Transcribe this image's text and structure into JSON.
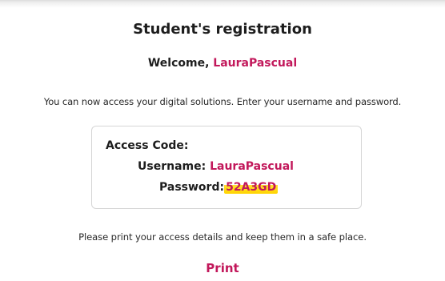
{
  "page": {
    "title": "Student's registration",
    "welcome_prefix": "Welcome, ",
    "welcome_name": "LauraPascual",
    "intro": "You can now access your digital solutions. Enter your username and password."
  },
  "credentials": {
    "access_code_label": "Access Code:",
    "username_label": "Username: ",
    "username_value": "LauraPascual",
    "password_label": "Password:",
    "password_value": "52A3GD"
  },
  "footer": {
    "note": "Please print your access details and keep them in a safe place.",
    "print_label": "Print"
  },
  "colors": {
    "accent": "#c2185b",
    "highlight": "#ffd400",
    "text": "#1d1d1d"
  }
}
